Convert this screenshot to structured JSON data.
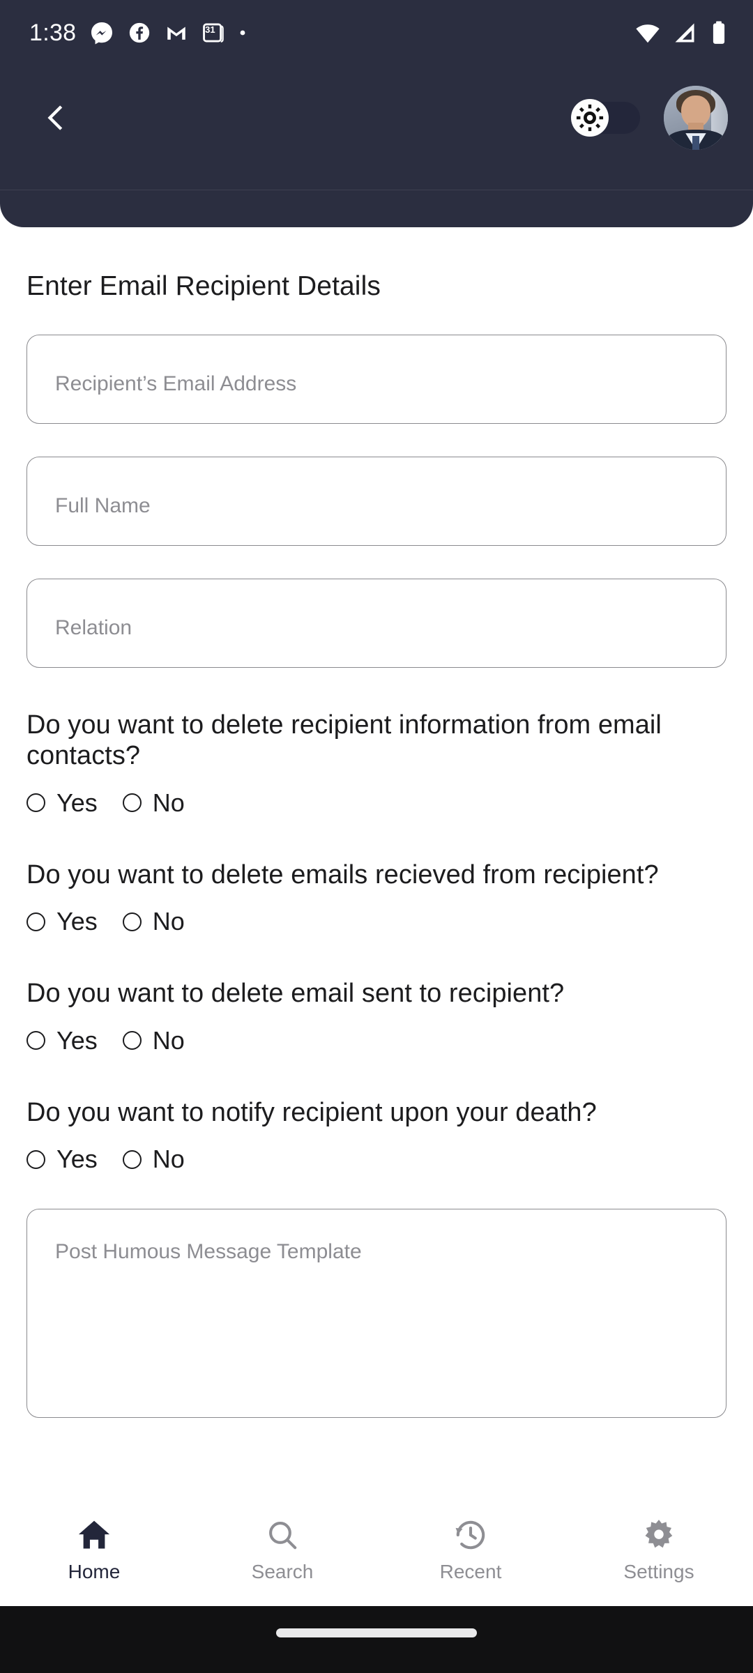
{
  "status_bar": {
    "time": "1:38",
    "left_icons": [
      "messenger-icon",
      "facebook-icon",
      "gmail-icon",
      "calendar-icon",
      "dot-indicator-icon"
    ],
    "calendar_day": "31",
    "right_icons": [
      "wifi-icon",
      "cellular-signal-icon",
      "battery-icon"
    ]
  },
  "app_bar": {
    "back_label": "Back",
    "theme_toggle": {
      "name": "theme-toggle",
      "state": "light",
      "icon": "sun-icon"
    },
    "avatar_label": "Profile"
  },
  "main": {
    "title": "Enter Email Recipient Details",
    "fields": [
      {
        "name": "recipient-email-input",
        "placeholder": "Recipient’s Email Address",
        "value": ""
      },
      {
        "name": "full-name-input",
        "placeholder": "Full Name",
        "value": ""
      },
      {
        "name": "relation-input",
        "placeholder": "Relation",
        "value": ""
      }
    ],
    "questions": [
      {
        "name": "delete-contact-info-question",
        "text": "Do you want to delete recipient information from email contacts?",
        "options": [
          "Yes",
          "No"
        ],
        "selected": ""
      },
      {
        "name": "delete-received-emails-question",
        "text": "Do you want to delete emails recieved from recipient?",
        "options": [
          "Yes",
          "No"
        ],
        "selected": ""
      },
      {
        "name": "delete-sent-emails-question",
        "text": "Do you want to delete email sent to recipient?",
        "options": [
          "Yes",
          "No"
        ],
        "selected": ""
      },
      {
        "name": "notify-on-death-question",
        "text": "Do you want to notify recipient upon your death?",
        "options": [
          "Yes",
          "No"
        ],
        "selected": ""
      }
    ],
    "message_template": {
      "name": "post-humous-message-textarea",
      "placeholder": "Post Humous Message Template",
      "value": ""
    }
  },
  "bottom_nav": {
    "active": "Home",
    "items": [
      {
        "label": "Home",
        "icon": "home-icon",
        "active": true
      },
      {
        "label": "Search",
        "icon": "search-icon",
        "active": false
      },
      {
        "label": "Recent",
        "icon": "history-clock-icon",
        "active": false
      },
      {
        "label": "Settings",
        "icon": "gear-icon",
        "active": false
      }
    ]
  },
  "colors": {
    "header_bg": "#2b2e40",
    "accent_dark": "#23263a",
    "text_primary": "#1c1c1e",
    "text_muted": "#8e8e93",
    "field_border": "#8a8a8e",
    "gesture_bar": "#111112"
  }
}
